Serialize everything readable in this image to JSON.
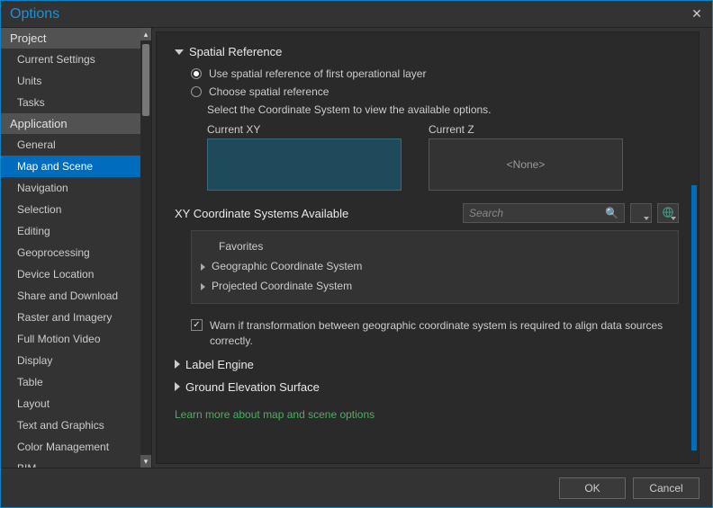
{
  "window": {
    "title": "Options"
  },
  "buttons": {
    "ok": "OK",
    "cancel": "Cancel"
  },
  "sidebar": {
    "groups": [
      {
        "header": "Project",
        "items": [
          "Current Settings",
          "Units",
          "Tasks"
        ]
      },
      {
        "header": "Application",
        "items": [
          "General",
          "Map and Scene",
          "Navigation",
          "Selection",
          "Editing",
          "Geoprocessing",
          "Device Location",
          "Share and Download",
          "Raster and Imagery",
          "Full Motion Video",
          "Display",
          "Table",
          "Layout",
          "Text and Graphics",
          "Color Management",
          "BIM"
        ]
      }
    ],
    "selected": "Map and Scene"
  },
  "main": {
    "spatial_reference": {
      "title": "Spatial Reference",
      "radio1": "Use spatial reference of first operational layer",
      "radio2": "Choose spatial reference",
      "helper": "Select the Coordinate System to view the available options.",
      "current_xy_label": "Current XY",
      "current_z_label": "Current Z",
      "current_z_value": "<None>",
      "available_label": "XY Coordinate Systems Available",
      "search_placeholder": "Search",
      "tree": {
        "favorites": "Favorites",
        "gcs": "Geographic Coordinate System",
        "pcs": "Projected Coordinate System"
      },
      "warn": "Warn if transformation between geographic coordinate system is required to align data sources correctly."
    },
    "label_engine": {
      "title": "Label Engine"
    },
    "ground_elev": {
      "title": "Ground Elevation Surface"
    },
    "learn_more": "Learn more about map and scene options"
  }
}
